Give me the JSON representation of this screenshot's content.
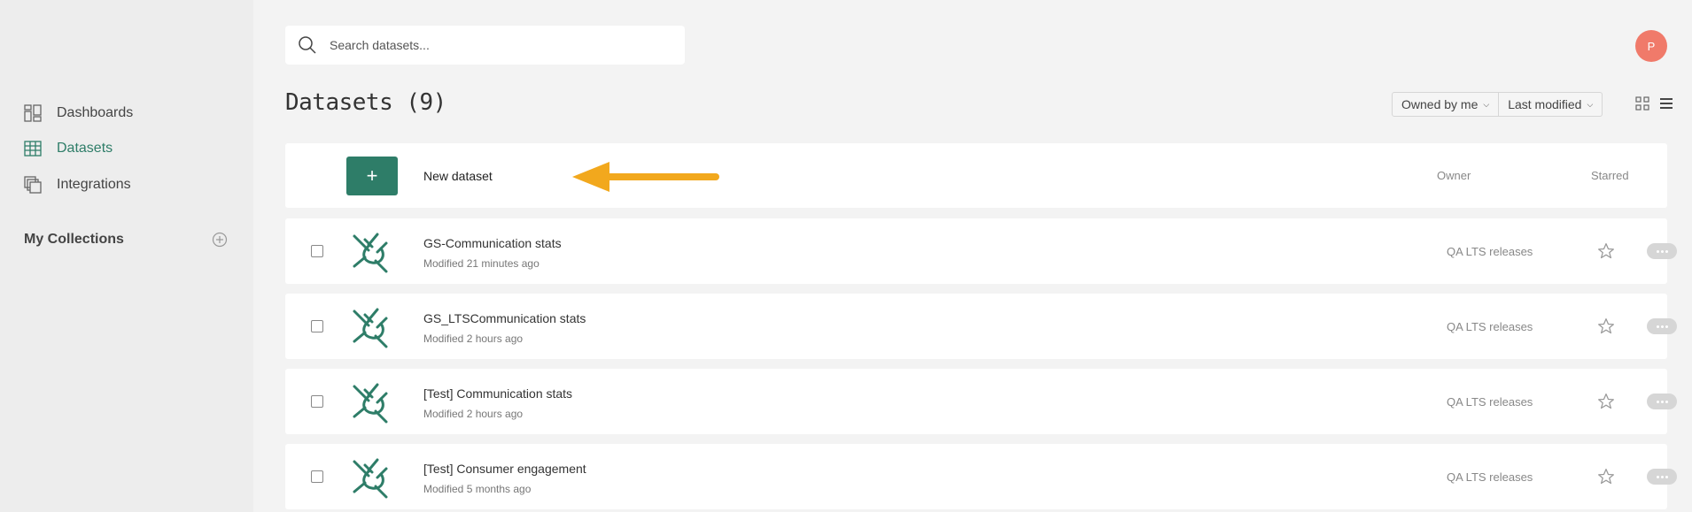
{
  "sidebar": {
    "items": [
      {
        "label": "Dashboards",
        "icon": "dashboards-icon",
        "active": false
      },
      {
        "label": "Datasets",
        "icon": "datasets-icon",
        "active": true
      },
      {
        "label": "Integrations",
        "icon": "integrations-icon",
        "active": false
      }
    ],
    "collections_label": "My Collections"
  },
  "search": {
    "placeholder": "Search datasets..."
  },
  "user": {
    "avatar_initial": "P"
  },
  "page": {
    "title": "Datasets (9)"
  },
  "filters": {
    "owner": "Owned by me",
    "sort": "Last modified"
  },
  "new_dataset": {
    "plus": "+",
    "label": "New dataset"
  },
  "columns": {
    "owner": "Owner",
    "starred": "Starred"
  },
  "datasets": [
    {
      "name": "GS-Communication stats",
      "modified": "Modified 21 minutes ago",
      "owner": "QA LTS releases"
    },
    {
      "name": "GS_LTSCommunication stats",
      "modified": "Modified 2 hours ago",
      "owner": "QA LTS releases"
    },
    {
      "name": "[Test] Communication stats",
      "modified": "Modified 2 hours ago",
      "owner": "QA LTS releases"
    },
    {
      "name": "[Test] Consumer engagement",
      "modified": "Modified 5 months ago",
      "owner": "QA LTS releases"
    }
  ],
  "colors": {
    "accent": "#2e7d68",
    "avatar": "#f07a6a",
    "arrow": "#f2a81d"
  }
}
